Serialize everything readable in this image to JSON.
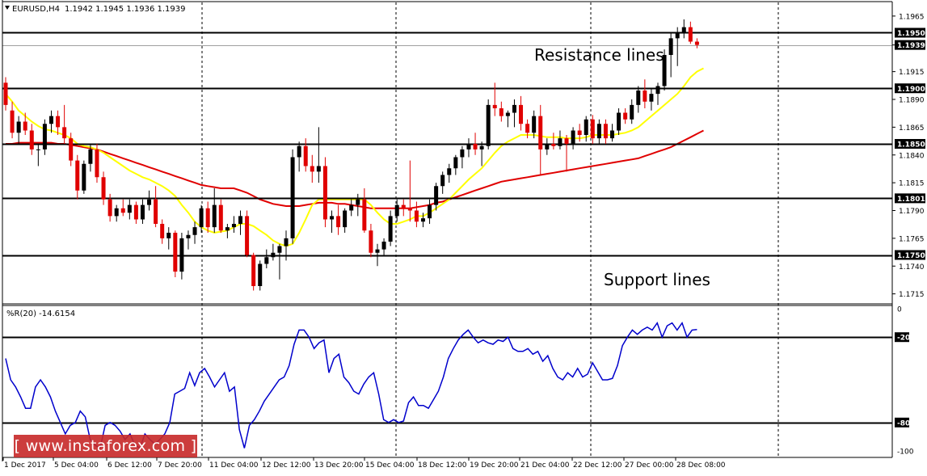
{
  "header": {
    "symbol": "EURUSD,H4",
    "ohlc": "1.1942 1.1945 1.1936 1.1939"
  },
  "annotations": {
    "resistance": "Resistance lines",
    "support": "Support lines"
  },
  "watermark": "[ www.instaforex.com ]",
  "colors": {
    "bull": "#000000",
    "bear": "#e00000",
    "ma_fast": "#ffff00",
    "ma_slow": "#e00000",
    "wpr": "#0000cc",
    "bg": "#ffffff"
  },
  "chart_data": [
    {
      "type": "candlestick",
      "title": "EURUSD,H4",
      "ylim": [
        1.1706,
        1.1978
      ],
      "price_ticks": [
        "1.1965",
        "1.1939",
        "1.1915",
        "1.1890",
        "1.1865",
        "1.1840",
        "1.1815",
        "1.1790",
        "1.1765",
        "1.1740",
        "1.1715"
      ],
      "price_tick_values": [
        1.1965,
        1.1939,
        1.1915,
        1.189,
        1.1865,
        1.184,
        1.1815,
        1.179,
        1.1765,
        1.174,
        1.1715
      ],
      "highlighted_levels": [
        "1.1950",
        "1.1939",
        "1.1900",
        "1.1850",
        "1.1801",
        "1.1750"
      ],
      "highlighted_level_values": [
        1.195,
        1.1939,
        1.19,
        1.185,
        1.1801,
        1.175
      ],
      "current_price": 1.1939,
      "resistance_levels": [
        1.195,
        1.19,
        1.185
      ],
      "support_levels": [
        1.1801,
        1.175
      ],
      "time_labels": [
        "1 Dec 2017",
        "5 Dec 04:00",
        "6 Dec 12:00",
        "7 Dec 20:00",
        "11 Dec 04:00",
        "12 Dec 12:00",
        "13 Dec 20:00",
        "15 Dec 04:00",
        "18 Dec 12:00",
        "19 Dec 20:00",
        "21 Dec 04:00",
        "22 Dec 12:00",
        "27 Dec 00:00",
        "28 Dec 08:00"
      ],
      "ohlc": [
        [
          1.1905,
          1.191,
          1.188,
          1.1885
        ],
        [
          1.188,
          1.1888,
          1.1855,
          1.186
        ],
        [
          1.186,
          1.1875,
          1.185,
          1.187
        ],
        [
          1.187,
          1.1878,
          1.1858,
          1.1862
        ],
        [
          1.1862,
          1.1868,
          1.184,
          1.1845
        ],
        [
          1.1845,
          1.185,
          1.183,
          1.1845
        ],
        [
          1.1845,
          1.1872,
          1.184,
          1.1868
        ],
        [
          1.1868,
          1.188,
          1.186,
          1.1875
        ],
        [
          1.1875,
          1.188,
          1.1858,
          1.1865
        ],
        [
          1.1865,
          1.1885,
          1.185,
          1.1855
        ],
        [
          1.1855,
          1.186,
          1.183,
          1.1835
        ],
        [
          1.1835,
          1.184,
          1.18,
          1.1808
        ],
        [
          1.1808,
          1.1835,
          1.1805,
          1.1832
        ],
        [
          1.1832,
          1.185,
          1.1825,
          1.1845
        ],
        [
          1.1845,
          1.185,
          1.1815,
          1.182
        ],
        [
          1.182,
          1.1825,
          1.1795,
          1.18
        ],
        [
          1.18,
          1.1805,
          1.178,
          1.1785
        ],
        [
          1.1785,
          1.1795,
          1.178,
          1.1792
        ],
        [
          1.1792,
          1.18,
          1.1785,
          1.1788
        ],
        [
          1.1788,
          1.18,
          1.1782,
          1.1795
        ],
        [
          1.1795,
          1.1798,
          1.1778,
          1.1782
        ],
        [
          1.1782,
          1.18,
          1.1778,
          1.1795
        ],
        [
          1.1795,
          1.1808,
          1.179,
          1.18
        ],
        [
          1.18,
          1.1812,
          1.1775,
          1.1778
        ],
        [
          1.1778,
          1.1782,
          1.176,
          1.1765
        ],
        [
          1.1765,
          1.1775,
          1.1755,
          1.177
        ],
        [
          1.177,
          1.1772,
          1.173,
          1.1735
        ],
        [
          1.1735,
          1.177,
          1.1728,
          1.1765
        ],
        [
          1.1765,
          1.1772,
          1.1755,
          1.1768
        ],
        [
          1.1768,
          1.178,
          1.176,
          1.1775
        ],
        [
          1.1775,
          1.1795,
          1.177,
          1.1792
        ],
        [
          1.1792,
          1.1798,
          1.177,
          1.1775
        ],
        [
          1.1775,
          1.181,
          1.177,
          1.1795
        ],
        [
          1.1795,
          1.18,
          1.177,
          1.1772
        ],
        [
          1.1772,
          1.1778,
          1.1765,
          1.1775
        ],
        [
          1.1775,
          1.1785,
          1.177,
          1.1778
        ],
        [
          1.1778,
          1.179,
          1.1768,
          1.1785
        ],
        [
          1.1785,
          1.179,
          1.1748,
          1.175
        ],
        [
          1.175,
          1.1752,
          1.1718,
          1.1722
        ],
        [
          1.1722,
          1.1745,
          1.1718,
          1.1742
        ],
        [
          1.1742,
          1.1755,
          1.1738,
          1.1748
        ],
        [
          1.1748,
          1.176,
          1.1745,
          1.1752
        ],
        [
          1.1752,
          1.176,
          1.1728,
          1.1758
        ],
        [
          1.1758,
          1.1772,
          1.1745,
          1.1765
        ],
        [
          1.1765,
          1.1845,
          1.176,
          1.1838
        ],
        [
          1.1838,
          1.1852,
          1.1825,
          1.1848
        ],
        [
          1.1848,
          1.1855,
          1.1825,
          1.183
        ],
        [
          1.183,
          1.184,
          1.1815,
          1.1825
        ],
        [
          1.1825,
          1.1865,
          1.1815,
          1.183
        ],
        [
          1.183,
          1.1838,
          1.1775,
          1.1782
        ],
        [
          1.1782,
          1.179,
          1.177,
          1.1785
        ],
        [
          1.1785,
          1.1795,
          1.1768,
          1.1775
        ],
        [
          1.1775,
          1.1792,
          1.177,
          1.179
        ],
        [
          1.179,
          1.18,
          1.1785,
          1.1795
        ],
        [
          1.1795,
          1.1805,
          1.1785,
          1.18
        ],
        [
          1.18,
          1.181,
          1.177,
          1.1772
        ],
        [
          1.1772,
          1.1778,
          1.1748,
          1.1752
        ],
        [
          1.1752,
          1.176,
          1.174,
          1.1755
        ],
        [
          1.1755,
          1.1765,
          1.175,
          1.1762
        ],
        [
          1.1762,
          1.179,
          1.1758,
          1.1785
        ],
        [
          1.1785,
          1.18,
          1.178,
          1.1795
        ],
        [
          1.1795,
          1.18,
          1.1785,
          1.1792
        ],
        [
          1.1792,
          1.1835,
          1.178,
          1.179
        ],
        [
          1.179,
          1.1798,
          1.1775,
          1.178
        ],
        [
          1.178,
          1.1788,
          1.1775,
          1.1783
        ],
        [
          1.1783,
          1.18,
          1.1778,
          1.1795
        ],
        [
          1.1795,
          1.1815,
          1.179,
          1.1812
        ],
        [
          1.1812,
          1.1825,
          1.1805,
          1.1822
        ],
        [
          1.1822,
          1.1832,
          1.1815,
          1.1828
        ],
        [
          1.1828,
          1.184,
          1.1822,
          1.1838
        ],
        [
          1.1838,
          1.1848,
          1.1828,
          1.1845
        ],
        [
          1.1845,
          1.1855,
          1.1838,
          1.185
        ],
        [
          1.185,
          1.186,
          1.184,
          1.1845
        ],
        [
          1.1845,
          1.1852,
          1.183,
          1.1848
        ],
        [
          1.1848,
          1.189,
          1.1845,
          1.1885
        ],
        [
          1.1885,
          1.1905,
          1.1875,
          1.1882
        ],
        [
          1.1882,
          1.1888,
          1.187,
          1.1875
        ],
        [
          1.1875,
          1.188,
          1.1865,
          1.1878
        ],
        [
          1.1878,
          1.189,
          1.1865,
          1.1885
        ],
        [
          1.1885,
          1.1893,
          1.1862,
          1.1868
        ],
        [
          1.1868,
          1.1872,
          1.1855,
          1.186
        ],
        [
          1.186,
          1.188,
          1.1855,
          1.1875
        ],
        [
          1.1875,
          1.1885,
          1.1822,
          1.1845
        ],
        [
          1.1845,
          1.1855,
          1.184,
          1.185
        ],
        [
          1.185,
          1.186,
          1.1845,
          1.1848
        ],
        [
          1.1848,
          1.1862,
          1.1845,
          1.1855
        ],
        [
          1.1855,
          1.1858,
          1.1825,
          1.185
        ],
        [
          1.185,
          1.1865,
          1.1845,
          1.1862
        ],
        [
          1.1862,
          1.1868,
          1.1852,
          1.1858
        ],
        [
          1.1858,
          1.1875,
          1.1852,
          1.1872
        ],
        [
          1.1872,
          1.1876,
          1.185,
          1.1855
        ],
        [
          1.1855,
          1.1872,
          1.185,
          1.1868
        ],
        [
          1.1868,
          1.1872,
          1.185,
          1.1855
        ],
        [
          1.1855,
          1.1868,
          1.1852,
          1.1862
        ],
        [
          1.1862,
          1.1882,
          1.1858,
          1.1878
        ],
        [
          1.1878,
          1.1882,
          1.1868,
          1.1872
        ],
        [
          1.1872,
          1.189,
          1.1868,
          1.1885
        ],
        [
          1.1885,
          1.1902,
          1.1878,
          1.1898
        ],
        [
          1.1898,
          1.1908,
          1.1882,
          1.1888
        ],
        [
          1.1888,
          1.19,
          1.188,
          1.1895
        ],
        [
          1.1895,
          1.1905,
          1.1885,
          1.1902
        ],
        [
          1.1902,
          1.1935,
          1.1898,
          1.193
        ],
        [
          1.193,
          1.195,
          1.191,
          1.1945
        ],
        [
          1.1945,
          1.1955,
          1.192,
          1.195
        ],
        [
          1.195,
          1.1962,
          1.1945,
          1.1955
        ],
        [
          1.1955,
          1.196,
          1.194,
          1.1942
        ],
        [
          1.1942,
          1.1945,
          1.1936,
          1.1939
        ]
      ],
      "ma_fast": [
        1.1895,
        1.1888,
        1.188,
        1.1875,
        1.187,
        1.1866,
        1.1863,
        1.1862,
        1.186,
        1.1858,
        1.1855,
        1.185,
        1.1848,
        1.1847,
        1.1845,
        1.1842,
        1.1838,
        1.1834,
        1.183,
        1.1826,
        1.1823,
        1.182,
        1.1818,
        1.1815,
        1.1812,
        1.1808,
        1.1803,
        1.1795,
        1.1788,
        1.178,
        1.1775,
        1.1772,
        1.177,
        1.1771,
        1.1772,
        1.1775,
        1.1778,
        1.1778,
        1.1776,
        1.1772,
        1.1768,
        1.1763,
        1.176,
        1.1758,
        1.176,
        1.177,
        1.1782,
        1.1795,
        1.18,
        1.18,
        1.18,
        1.18,
        1.18,
        1.18,
        1.18,
        1.18,
        1.1795,
        1.1788,
        1.1782,
        1.1778,
        1.1778,
        1.178,
        1.1782,
        1.1785,
        1.1785,
        1.1788,
        1.1792,
        1.1796,
        1.18,
        1.1806,
        1.1812,
        1.1818,
        1.1823,
        1.1828,
        1.1835,
        1.1842,
        1.1848,
        1.1852,
        1.1855,
        1.1858,
        1.1858,
        1.1858,
        1.1857,
        1.1856,
        1.1856,
        1.1856,
        1.1855,
        1.1855,
        1.1855,
        1.1856,
        1.1858,
        1.1858,
        1.1858,
        1.1858,
        1.1859,
        1.186,
        1.1862,
        1.1865,
        1.187,
        1.1875,
        1.188,
        1.1885,
        1.189,
        1.1895,
        1.1902,
        1.191,
        1.1915,
        1.1918
      ],
      "ma_slow": [
        1.185,
        1.185,
        1.1851,
        1.1851,
        1.1851,
        1.1851,
        1.1851,
        1.1851,
        1.185,
        1.185,
        1.1849,
        1.1848,
        1.1847,
        1.1846,
        1.1845,
        1.1843,
        1.1841,
        1.1839,
        1.1837,
        1.1835,
        1.1833,
        1.1831,
        1.1829,
        1.1827,
        1.1825,
        1.1823,
        1.1821,
        1.1819,
        1.1817,
        1.1815,
        1.1813,
        1.1812,
        1.1811,
        1.181,
        1.181,
        1.181,
        1.1808,
        1.1806,
        1.1803,
        1.18,
        1.1798,
        1.1796,
        1.1795,
        1.1794,
        1.1794,
        1.1794,
        1.1795,
        1.1796,
        1.1797,
        1.1797,
        1.1797,
        1.1796,
        1.1796,
        1.1795,
        1.1794,
        1.1793,
        1.1792,
        1.1792,
        1.1792,
        1.1792,
        1.1792,
        1.1792,
        1.1792,
        1.1793,
        1.1794,
        1.1795,
        1.1797,
        1.1798,
        1.18,
        1.1802,
        1.1804,
        1.1806,
        1.1808,
        1.181,
        1.1812,
        1.1814,
        1.1816,
        1.1817,
        1.1818,
        1.1819,
        1.182,
        1.1821,
        1.1822,
        1.1823,
        1.1824,
        1.1825,
        1.1826,
        1.1827,
        1.1828,
        1.1829,
        1.183,
        1.1831,
        1.1832,
        1.1833,
        1.1834,
        1.1835,
        1.1836,
        1.1837,
        1.1839,
        1.1841,
        1.1843,
        1.1845,
        1.1847,
        1.185,
        1.1853,
        1.1856,
        1.1859,
        1.1862
      ]
    },
    {
      "type": "line",
      "title": "%R(20) -14.6154",
      "ylim": [
        -100,
        0
      ],
      "ticks": [
        "0",
        "-20",
        "-80",
        "-100"
      ],
      "tick_values": [
        0,
        -20,
        -80,
        -100
      ],
      "levels": [
        -20,
        -80
      ],
      "values": [
        -35,
        -50,
        -55,
        -62,
        -70,
        -70,
        -55,
        -50,
        -55,
        -62,
        -72,
        -80,
        -88,
        -82,
        -80,
        -72,
        -76,
        -92,
        -96,
        -98,
        -82,
        -80,
        -82,
        -86,
        -92,
        -88,
        -96,
        -98,
        -88,
        -92,
        -95,
        -92,
        -88,
        -80,
        -60,
        -58,
        -56,
        -45,
        -54,
        -45,
        -42,
        -48,
        -55,
        -50,
        -45,
        -58,
        -55,
        -85,
        -98,
        -82,
        -78,
        -72,
        -65,
        -60,
        -55,
        -50,
        -48,
        -40,
        -25,
        -15,
        -15,
        -20,
        -28,
        -24,
        -22,
        -45,
        -35,
        -32,
        -48,
        -52,
        -58,
        -60,
        -53,
        -48,
        -45,
        -60,
        -78,
        -80,
        -78,
        -80,
        -79,
        -66,
        -62,
        -68,
        -68,
        -70,
        -64,
        -58,
        -48,
        -35,
        -28,
        -22,
        -18,
        -15,
        -20,
        -24,
        -22,
        -24,
        -25,
        -22,
        -23,
        -20,
        -28,
        -30,
        -30,
        -28,
        -32,
        -30,
        -37,
        -33,
        -42,
        -48,
        -50,
        -45,
        -48,
        -42,
        -48,
        -46,
        -38,
        -44,
        -50,
        -50,
        -49,
        -40,
        -26,
        -20,
        -15,
        -18,
        -15,
        -13,
        -15,
        -10,
        -20,
        -12,
        -10,
        -15,
        -10,
        -20,
        -15,
        -14.6
      ]
    }
  ]
}
